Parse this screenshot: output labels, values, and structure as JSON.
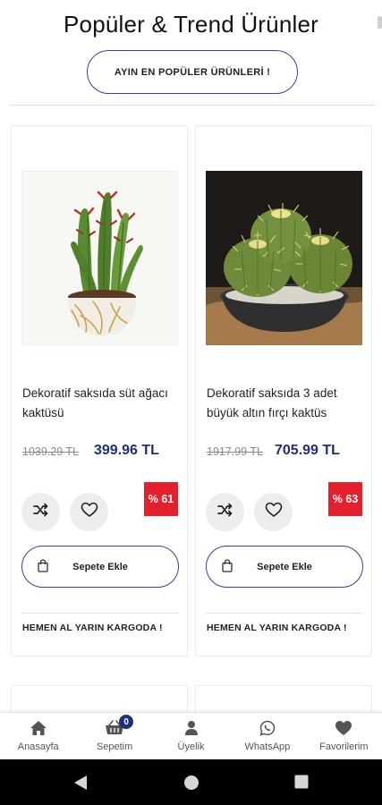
{
  "header": {
    "title": "Popüler & Trend Ürünler",
    "popular_button": "AYIN EN POPÜLER ÜRÜNLERİ !"
  },
  "products": [
    {
      "name": "Dekoratif saksıda süt ağacı kaktüsü",
      "old_price": "1039.29 TL",
      "new_price": "399.96 TL",
      "discount": "% 61",
      "cart_label": "Sepete Ekle",
      "shipping_note": "HEMEN AL YARIN KARGODA !"
    },
    {
      "name": "Dekoratif saksıda 3 adet büyük altın fırçı kaktüs",
      "old_price": "1917.99 TL",
      "new_price": "705.99 TL",
      "discount": "% 63",
      "cart_label": "Sepete Ekle",
      "shipping_note": "HEMEN AL YARIN KARGODA !"
    }
  ],
  "bottom_nav": {
    "items": [
      {
        "label": "Anasayfa",
        "icon": "home-icon"
      },
      {
        "label": "Sepetim",
        "icon": "basket-icon",
        "badge": "0"
      },
      {
        "label": "Üyelik",
        "icon": "user-icon"
      },
      {
        "label": "WhatsApp",
        "icon": "whatsapp-icon"
      },
      {
        "label": "Favorilerim",
        "icon": "heart-icon"
      }
    ]
  },
  "colors": {
    "accent": "#1f2f7a",
    "discount": "#e3202e",
    "outline": "#3b3f9e"
  }
}
